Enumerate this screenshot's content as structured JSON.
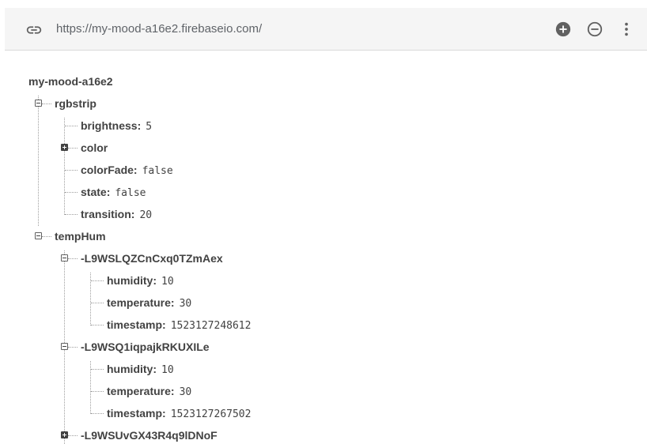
{
  "toolbar": {
    "url": "https://my-mood-a16e2.firebaseio.com/",
    "icons": [
      "link-icon",
      "add-circle-icon",
      "remove-circle-icon",
      "more-vert-icon"
    ]
  },
  "tree": {
    "root": "my-mood-a16e2",
    "rgbstrip": {
      "label": "rgbstrip",
      "children": [
        {
          "key": "brightness",
          "value": "5"
        },
        {
          "key": "color"
        },
        {
          "key": "colorFade",
          "value": "false"
        },
        {
          "key": "state",
          "value": "false"
        },
        {
          "key": "transition",
          "value": "20"
        }
      ]
    },
    "tempHum": {
      "label": "tempHum",
      "entries": [
        {
          "id": "-L9WSLQZCnCxq0TZmAex",
          "children": [
            {
              "key": "humidity",
              "value": "10"
            },
            {
              "key": "temperature",
              "value": "30"
            },
            {
              "key": "timestamp",
              "value": "1523127248612"
            }
          ]
        },
        {
          "id": "-L9WSQ1iqpajkRKUXILe",
          "children": [
            {
              "key": "humidity",
              "value": "10"
            },
            {
              "key": "temperature",
              "value": "30"
            },
            {
              "key": "timestamp",
              "value": "1523127267502"
            }
          ]
        },
        {
          "id": "-L9WSUvGX43R4q9lDNoF"
        }
      ]
    }
  }
}
